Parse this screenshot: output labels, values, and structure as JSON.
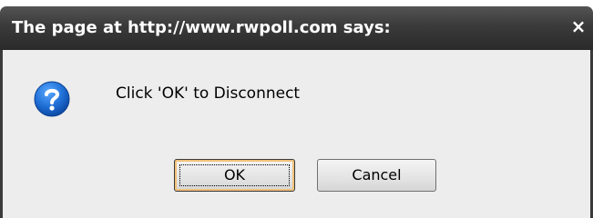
{
  "dialog": {
    "title": "The page at http://www.rwpoll.com says:",
    "close_glyph": "×",
    "icon": "question-icon",
    "message": "Click 'OK' to Disconnect",
    "ok_label": "OK",
    "cancel_label": "Cancel"
  },
  "colors": {
    "titlebar": "#3a3a3a",
    "body": "#ededed",
    "icon_blue": "#1f6fd6",
    "ok_focus": "#f2c27a"
  }
}
